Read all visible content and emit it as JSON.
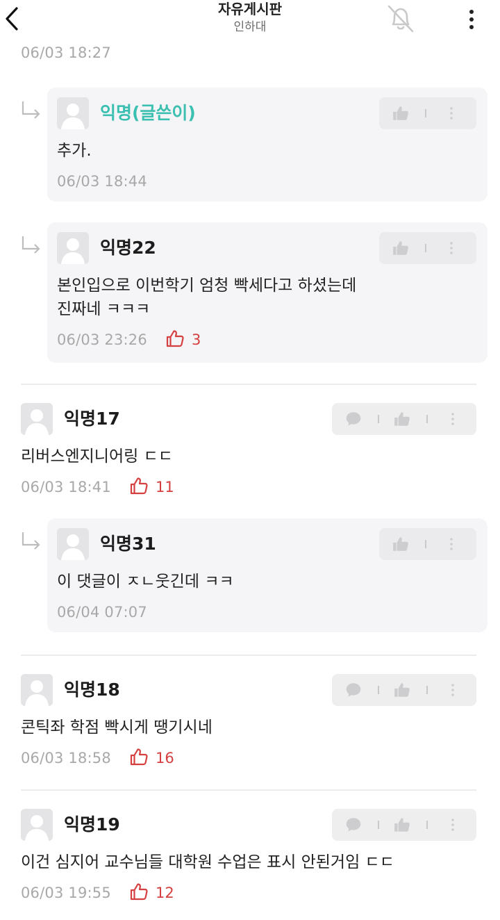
{
  "header": {
    "title": "자유게시판",
    "subtitle": "인하대",
    "back_icon": "chevron-left-icon",
    "bell_icon": "bell-off-icon",
    "menu_icon": "more-vertical-icon"
  },
  "top_timestamp": "06/03 18:27",
  "colors": {
    "author_accent": "#3bbfb0",
    "like_red": "#d63f3f"
  },
  "comments": [
    {
      "type": "reply",
      "name": "익명(글쓴이)",
      "body": [
        "추가."
      ],
      "timestamp": "06/03 18:44",
      "likes": null
    },
    {
      "type": "reply",
      "name": "익명22",
      "body": [
        "본인입으로 이번학기 엄청 빡세다고 하셨는데",
        "진짜네 ㅋㅋㅋ"
      ],
      "timestamp": "06/03 23:26",
      "likes": "3"
    },
    {
      "type": "comment",
      "name": "익명17",
      "body": [
        "리버스엔지니어링 ㄷㄷ"
      ],
      "timestamp": "06/03 18:41",
      "likes": "11"
    },
    {
      "type": "reply",
      "name": "익명31",
      "body": [
        "이 댓글이 ㅈㄴ웃긴데 ㅋㅋ"
      ],
      "timestamp": "06/04 07:07",
      "likes": null
    },
    {
      "type": "comment",
      "name": "익명18",
      "body": [
        "콘틱좌 학점 빡시게 땡기시네"
      ],
      "timestamp": "06/03 18:58",
      "likes": "16"
    },
    {
      "type": "comment",
      "name": "익명19",
      "body": [
        "이건 심지어 교수님들 대학원 수업은 표시 안된거임 ㄷㄷ"
      ],
      "timestamp": "06/03 19:55",
      "likes": "12"
    }
  ]
}
